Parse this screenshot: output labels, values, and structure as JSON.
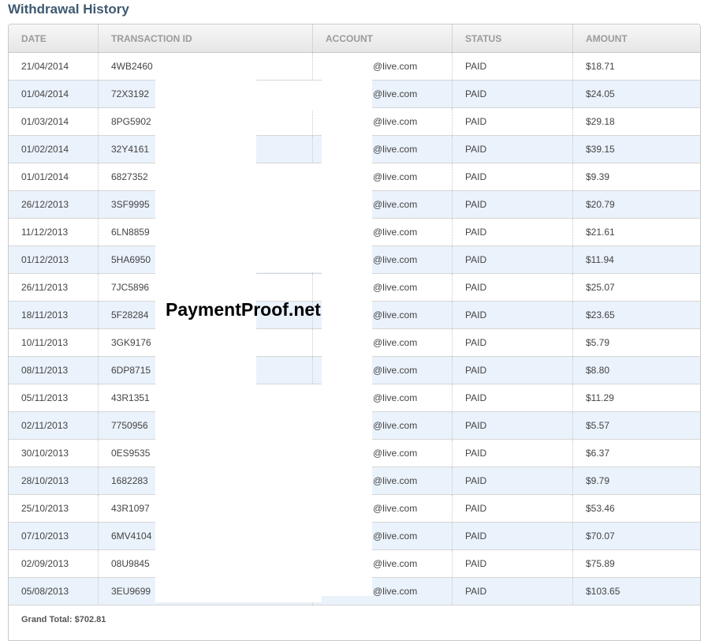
{
  "page": {
    "title": "Withdrawal History"
  },
  "table": {
    "headers": [
      "DATE",
      "TRANSACTION ID",
      "ACCOUNT",
      "STATUS",
      "AMOUNT"
    ],
    "rows": [
      {
        "date": "21/04/2014",
        "tx": "4WB2460",
        "account": "@live.com",
        "status": "PAID",
        "amount": "$18.71"
      },
      {
        "date": "01/04/2014",
        "tx": "72X3192",
        "account": "@live.com",
        "status": "PAID",
        "amount": "$24.05"
      },
      {
        "date": "01/03/2014",
        "tx": "8PG5902",
        "account": "@live.com",
        "status": "PAID",
        "amount": "$29.18"
      },
      {
        "date": "01/02/2014",
        "tx": "32Y4161",
        "account": "@live.com",
        "status": "PAID",
        "amount": "$39.15"
      },
      {
        "date": "01/01/2014",
        "tx": "6827352",
        "account": "@live.com",
        "status": "PAID",
        "amount": "$9.39"
      },
      {
        "date": "26/12/2013",
        "tx": "3SF9995",
        "account": "@live.com",
        "status": "PAID",
        "amount": "$20.79"
      },
      {
        "date": "11/12/2013",
        "tx": "6LN8859",
        "account": "@live.com",
        "status": "PAID",
        "amount": "$21.61"
      },
      {
        "date": "01/12/2013",
        "tx": "5HA6950",
        "account": "@live.com",
        "status": "PAID",
        "amount": "$11.94"
      },
      {
        "date": "26/11/2013",
        "tx": "7JC5896",
        "account": "@live.com",
        "status": "PAID",
        "amount": "$25.07"
      },
      {
        "date": "18/11/2013",
        "tx": "5F28284",
        "account": "@live.com",
        "status": "PAID",
        "amount": "$23.65"
      },
      {
        "date": "10/11/2013",
        "tx": "3GK9176",
        "account": "@live.com",
        "status": "PAID",
        "amount": "$5.79"
      },
      {
        "date": "08/11/2013",
        "tx": "6DP8715",
        "account": "@live.com",
        "status": "PAID",
        "amount": "$8.80"
      },
      {
        "date": "05/11/2013",
        "tx": "43R1351",
        "account": "@live.com",
        "status": "PAID",
        "amount": "$11.29"
      },
      {
        "date": "02/11/2013",
        "tx": "7750956",
        "account": "@live.com",
        "status": "PAID",
        "amount": "$5.57"
      },
      {
        "date": "30/10/2013",
        "tx": "0ES9535",
        "account": "@live.com",
        "status": "PAID",
        "amount": "$6.37"
      },
      {
        "date": "28/10/2013",
        "tx": "1682283",
        "account": "@live.com",
        "status": "PAID",
        "amount": "$9.79"
      },
      {
        "date": "25/10/2013",
        "tx": "43R1097",
        "account": "@live.com",
        "status": "PAID",
        "amount": "$53.46"
      },
      {
        "date": "07/10/2013",
        "tx": "6MV4104",
        "account": "@live.com",
        "status": "PAID",
        "amount": "$70.07"
      },
      {
        "date": "02/09/2013",
        "tx": "08U9845",
        "account": "@live.com",
        "status": "PAID",
        "amount": "$75.89"
      },
      {
        "date": "05/08/2013",
        "tx": "3EU9699",
        "account": "@live.com",
        "status": "PAID",
        "amount": "$103.65"
      }
    ],
    "grand_total": "Grand Total: $702.81"
  },
  "watermark": "PaymentProof.net",
  "colors": {
    "title": "#3e5a72",
    "row_alt": "#eaf2fb",
    "header_text": "#9b9b9b"
  }
}
